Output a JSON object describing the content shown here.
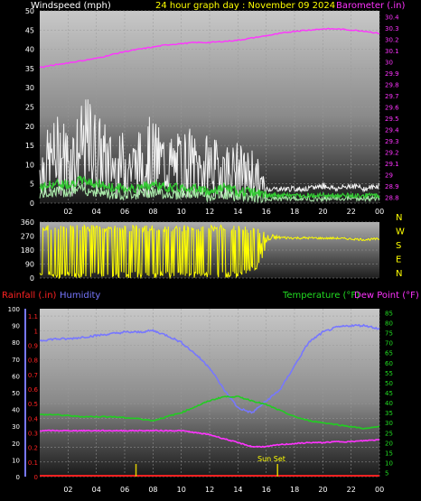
{
  "header": {
    "left_title": "Windspeed (mph)",
    "center_title": "24 hour graph day : November 09 2024",
    "right_title": "Barometer (.in)"
  },
  "colors": {
    "wind_speed": "#f2f2f2",
    "wind_avg": "#33cc33",
    "wind_light": "#a8e8a8",
    "barometer": "#ff33ff",
    "direction": "#ffff00",
    "humidity": "#7777ff",
    "temperature": "#22cc22",
    "dewpoint": "#ff33ff",
    "rainfall": "#ff2222",
    "sunset": "#ddcc00"
  },
  "chart_data": [
    {
      "type": "line",
      "title": "24 hour graph day : November 09 2024",
      "ylabel": "Windspeed (mph)",
      "y2label": "Barometer (.in)",
      "ylim": [
        0,
        50
      ],
      "y2lim": [
        28.75,
        30.45
      ],
      "y_ticks": [
        0,
        5,
        10,
        15,
        20,
        25,
        30,
        35,
        40,
        45,
        50
      ],
      "y2_ticks": [
        "28.8",
        "28.9",
        "29",
        "29.1",
        "29.2",
        "29.3",
        "29.4",
        "29.5",
        "29.6",
        "29.7",
        "29.8",
        "29.9",
        "30",
        "30.1",
        "30.2",
        "30.3",
        "30.4"
      ],
      "x_ticks": [
        "02",
        "04",
        "06",
        "08",
        "10",
        "12",
        "14",
        "16",
        "18",
        "20",
        "22",
        "00"
      ],
      "series": [
        {
          "role": "wind_gust",
          "x": [
            0,
            0.5,
            1,
            1.5,
            2,
            2.5,
            3,
            3.5,
            4,
            4.5,
            5,
            5.5,
            6,
            6.5,
            7,
            7.5,
            8,
            8.5,
            9,
            9.5,
            10,
            10.5,
            11,
            11.5,
            12,
            12.5,
            13,
            13.5,
            14,
            14.5,
            15,
            15.5,
            16,
            17,
            18,
            19,
            20,
            21,
            22,
            23,
            24
          ],
          "y": [
            12,
            14,
            16,
            18,
            15,
            17,
            19,
            21,
            18,
            16,
            14,
            12,
            15,
            13,
            14,
            17,
            16,
            15,
            14,
            13,
            14,
            15,
            13,
            12,
            14,
            12,
            13,
            11,
            12,
            10,
            11,
            8,
            4,
            4,
            4,
            4,
            5,
            4,
            5,
            4,
            5
          ]
        },
        {
          "role": "wind_avg",
          "x": [
            0,
            1,
            2,
            3,
            4,
            5,
            6,
            7,
            8,
            9,
            10,
            11,
            12,
            13,
            14,
            15,
            16,
            17,
            18,
            19,
            20,
            21,
            22,
            23,
            24
          ],
          "y": [
            4,
            5,
            5,
            6,
            5,
            4,
            4,
            4,
            5,
            4,
            4,
            4,
            3,
            4,
            3,
            3,
            2,
            2,
            2,
            2,
            2,
            2,
            2,
            2,
            2
          ]
        },
        {
          "role": "barometer",
          "x": [
            0,
            1,
            2,
            3,
            4,
            5,
            6,
            7,
            8,
            9,
            10,
            11,
            12,
            13,
            14,
            15,
            16,
            17,
            18,
            19,
            20,
            21,
            22,
            23,
            24
          ],
          "y": [
            29.95,
            29.97,
            29.99,
            30.01,
            30.03,
            30.06,
            30.09,
            30.11,
            30.13,
            30.15,
            30.16,
            30.17,
            30.17,
            30.18,
            30.19,
            30.21,
            30.23,
            30.25,
            30.27,
            30.28,
            30.29,
            30.29,
            30.28,
            30.27,
            30.25
          ]
        }
      ]
    },
    {
      "type": "scatter",
      "ylabel": "Wind direction",
      "ylim": [
        0,
        360
      ],
      "y_ticks": [
        0,
        90,
        180,
        270,
        360
      ],
      "compass": [
        "N",
        "W",
        "S",
        "E",
        "N"
      ],
      "x": [
        0,
        2,
        4,
        6,
        8,
        10,
        12,
        14,
        15.5,
        16,
        16.5,
        17,
        18,
        19,
        20,
        21,
        22,
        23,
        24
      ],
      "y_range_low": [
        0,
        0,
        0,
        0,
        0,
        0,
        0,
        0,
        60,
        180,
        240,
        250,
        250,
        250,
        250,
        250,
        245,
        240,
        245
      ],
      "y_range_high": [
        340,
        340,
        340,
        340,
        340,
        340,
        340,
        340,
        320,
        300,
        280,
        270,
        265,
        265,
        262,
        262,
        258,
        255,
        258
      ]
    },
    {
      "type": "line",
      "ylabel_left1": "Rainfall (.in)",
      "ylabel_left2": "Humidity",
      "ylabel_right1": "Temperature (°F)",
      "ylabel_right2": "Dew Point (°F)",
      "rain_ticks": [
        "0",
        "0.1",
        "0.2",
        "0.3",
        "0.4",
        "0.5",
        "0.6",
        "0.7",
        "0.8",
        "0.9",
        "1",
        "1.1"
      ],
      "humidity_ticks": [
        0,
        10,
        20,
        30,
        40,
        50,
        60,
        70,
        80,
        90,
        100
      ],
      "temp_ticks": [
        5,
        10,
        15,
        20,
        25,
        30,
        35,
        40,
        45,
        50,
        55,
        60,
        65,
        70,
        75,
        80,
        85
      ],
      "x_ticks": [
        "02",
        "04",
        "06",
        "08",
        "10",
        "12",
        "14",
        "16",
        "18",
        "20",
        "22",
        "00"
      ],
      "annotation": "Sun Set",
      "series": [
        {
          "role": "humidity",
          "x": [
            0,
            1,
            2,
            3,
            4,
            5,
            6,
            7,
            8,
            9,
            10,
            11,
            12,
            13,
            14,
            15,
            16,
            17,
            18,
            19,
            20,
            21,
            22,
            23,
            24
          ],
          "y": [
            81,
            82,
            82,
            83,
            84,
            85,
            86,
            86,
            87,
            84,
            80,
            73,
            65,
            52,
            41,
            38,
            45,
            52,
            66,
            80,
            86,
            89,
            90,
            90,
            88
          ]
        },
        {
          "role": "temperature",
          "x": [
            0,
            1,
            2,
            3,
            4,
            5,
            6,
            7,
            8,
            9,
            10,
            11,
            12,
            13,
            14,
            15,
            16,
            17,
            18,
            19,
            20,
            21,
            22,
            23,
            24
          ],
          "y": [
            34,
            34,
            33.5,
            33,
            33,
            33,
            32.5,
            32,
            31,
            33,
            35,
            38,
            41,
            43,
            43,
            41,
            39,
            36,
            33,
            31,
            30,
            29,
            28,
            27,
            28
          ]
        },
        {
          "role": "dewpoint",
          "x": [
            0,
            1,
            2,
            3,
            4,
            5,
            6,
            7,
            8,
            9,
            10,
            11,
            12,
            13,
            14,
            15,
            16,
            17,
            18,
            19,
            20,
            21,
            22,
            23,
            24
          ],
          "y": [
            26,
            26,
            26,
            26,
            26,
            26,
            26,
            26,
            26,
            26,
            26,
            25,
            24,
            22,
            20,
            18,
            18,
            19,
            19.5,
            20,
            20,
            20.5,
            20.5,
            21,
            21.5
          ]
        },
        {
          "role": "rainfall",
          "x": [
            0,
            24
          ],
          "y": [
            0,
            0
          ]
        }
      ],
      "sunset_hour": 16.8,
      "extra_marker_hour": 6.8
    }
  ]
}
